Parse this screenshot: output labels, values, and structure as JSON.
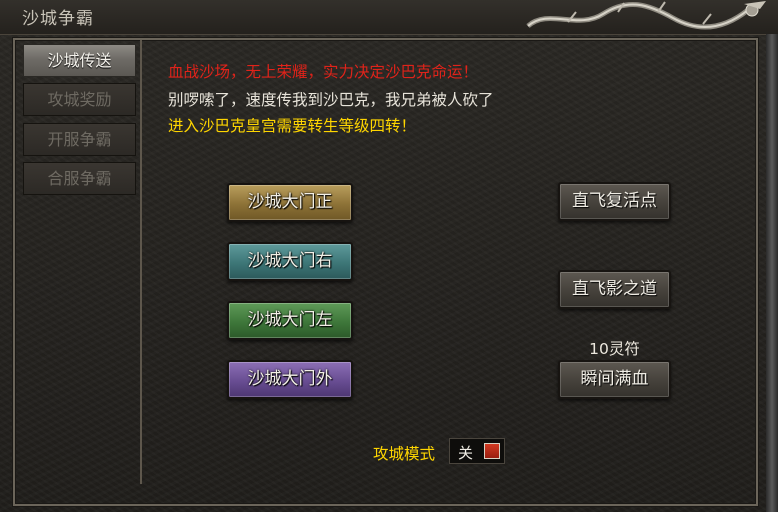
{
  "window": {
    "title": "沙城争霸"
  },
  "sidebar": {
    "tabs": [
      {
        "label": "沙城传送",
        "active": true
      },
      {
        "label": "攻城奖励",
        "active": false
      },
      {
        "label": "开服争霸",
        "active": false
      },
      {
        "label": "合服争霸",
        "active": false
      }
    ]
  },
  "messages": {
    "red": "血战沙场，无上荣耀，实力决定沙巴克命运！",
    "white": "别啰嗦了，速度传我到沙巴克，我兄弟被人砍了",
    "yellow": "进入沙巴克皇宫需要转生等级四转！"
  },
  "gates": {
    "front": "沙城大门正",
    "right": "沙城大门右",
    "left": "沙城大门左",
    "outer": "沙城大门外"
  },
  "actions": {
    "fly_respawn": "直飞复活点",
    "fly_shadow": "直飞影之道",
    "cost": "10灵符",
    "full_hp": "瞬间满血"
  },
  "siege_mode": {
    "label": "攻城模式",
    "value": "关"
  },
  "colors": {
    "red_text": "#e0231a",
    "yellow_text": "#ffd600",
    "gold_button": "#8d7237",
    "teal_button": "#3d7677",
    "green_button": "#3e773a",
    "purple_button": "#684d92"
  }
}
